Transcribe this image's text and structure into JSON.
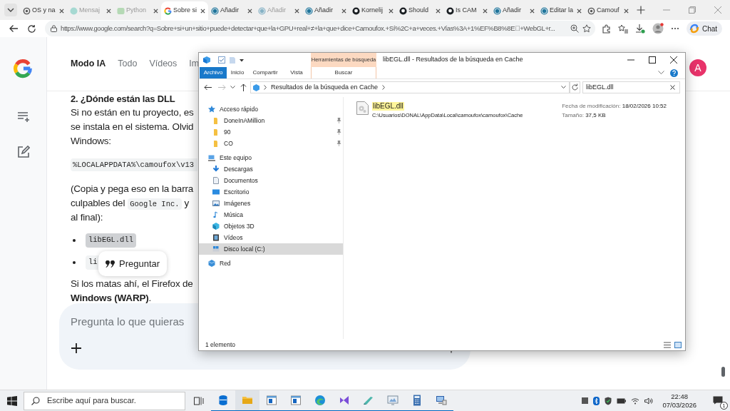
{
  "browser": {
    "tabs": [
      {
        "title": "OS y na",
        "kind": "knot",
        "selected": false,
        "sleeping": false
      },
      {
        "title": "Mensaj",
        "kind": "dot",
        "selected": false,
        "sleeping": true
      },
      {
        "title": "Python",
        "kind": "square",
        "selected": false,
        "sleeping": true
      },
      {
        "title": "Sobre si",
        "kind": "multicolor",
        "selected": true,
        "sleeping": false
      },
      {
        "title": "Añadir",
        "kind": "disc",
        "selected": false,
        "sleeping": false
      },
      {
        "title": "Añadir",
        "kind": "disc",
        "selected": false,
        "sleeping": true
      },
      {
        "title": "Añadir",
        "kind": "disc",
        "selected": false,
        "sleeping": false
      },
      {
        "title": "Kornelij",
        "kind": "cat",
        "selected": false,
        "sleeping": false
      },
      {
        "title": "Should",
        "kind": "cat",
        "selected": false,
        "sleeping": false
      },
      {
        "title": "Is CAM",
        "kind": "cat",
        "selected": false,
        "sleeping": false
      },
      {
        "title": "Añadir",
        "kind": "disc",
        "selected": false,
        "sleeping": false
      },
      {
        "title": "Editar la",
        "kind": "disc",
        "selected": false,
        "sleeping": false
      },
      {
        "title": "Camouf",
        "kind": "knot",
        "selected": false,
        "sleeping": false
      }
    ],
    "address": "https://www.google.com/search?q=Sobre+si+un+sitio+puede+detectar+que+la+GPU+real+≠+la+que+dice+Camoufox.+Sí%2C+a+veces.+Vías%3A+1%EF%B8%8E⃣+WebGL+r...",
    "chat_button": "Chat"
  },
  "page": {
    "nav": [
      {
        "label": "Modo IA",
        "selected": true
      },
      {
        "label": "Todo",
        "selected": false
      },
      {
        "label": "Vídeos",
        "selected": false
      },
      {
        "label": "Im",
        "selected": false
      }
    ],
    "avatar": "A",
    "heading": "2. ¿Dónde están las DLL",
    "blocks": [
      {
        "kind": "para",
        "lines": [
          "Si no están en tu proyecto, es",
          "se instala en el sistema. Olvid",
          "Windows:"
        ]
      },
      {
        "kind": "code",
        "text": "%LOCALAPPDATA%\\camoufox\\v13"
      },
      {
        "kind": "para",
        "lines": [
          "(Copia y pega eso en la barra",
          {
            "segments": [
              {
                "kind": "text",
                "text": "culpables del"
              },
              {
                "kind": "code",
                "text": "Google Inc."
              },
              {
                "kind": "text",
                "text": "y"
              }
            ]
          },
          "al final):"
        ]
      },
      {
        "kind": "list",
        "items": [
          {
            "text": "libEGL.dll",
            "highlighted": true
          },
          {
            "text": "li",
            "highlighted": false
          }
        ]
      },
      {
        "kind": "para",
        "lines": [
          "Si los matas ahí, el Firefox de",
          "**Windows (WARP)**."
        ]
      }
    ],
    "popup": "Preguntar",
    "prompt_placeholder": "Pregunta lo que quieras"
  },
  "explorer": {
    "title": "libEGL.dll - Resultados de la búsqueda en Cache",
    "context_group": "Herramientas de búsqueda",
    "ribbon_tabs": [
      {
        "label": "Archivo",
        "kind": "file"
      },
      {
        "label": "Inicio",
        "kind": "tab"
      },
      {
        "label": "Compartir",
        "kind": "tab"
      },
      {
        "label": "Vista",
        "kind": "tab"
      },
      {
        "label": "Buscar",
        "kind": "context"
      }
    ],
    "path": "Resultados de la búsqueda en Cache",
    "search": "libEGL.dll",
    "nav": [
      {
        "label": "Acceso rápido",
        "kind": "star",
        "selected": false,
        "children": [
          {
            "label": "DoneInAMillion",
            "kind": "folder",
            "pinned": true,
            "selected": false
          },
          {
            "label": "90",
            "kind": "folder",
            "pinned": true,
            "selected": false
          },
          {
            "label": "CO",
            "kind": "folder",
            "pinned": true,
            "selected": false
          }
        ]
      },
      {
        "label": "Este equipo",
        "kind": "pc",
        "selected": false,
        "children": [
          {
            "label": "Descargas",
            "kind": "download",
            "pinned": false,
            "selected": false
          },
          {
            "label": "Documentos",
            "kind": "document",
            "pinned": false,
            "selected": false
          },
          {
            "label": "Escritorio",
            "kind": "desktop",
            "pinned": false,
            "selected": false
          },
          {
            "label": "Imágenes",
            "kind": "image",
            "pinned": false,
            "selected": false
          },
          {
            "label": "Música",
            "kind": "music",
            "pinned": false,
            "selected": false
          },
          {
            "label": "Objetos 3D",
            "kind": "cube",
            "pinned": false,
            "selected": false
          },
          {
            "label": "Vídeos",
            "kind": "film",
            "pinned": false,
            "selected": false
          },
          {
            "label": "Disco local (C:)",
            "kind": "drive",
            "pinned": false,
            "selected": true
          }
        ]
      },
      {
        "label": "Red",
        "kind": "network",
        "selected": false
      }
    ],
    "results": [
      {
        "name": "libEGL.dll",
        "path": "C:\\Usuarios\\DONAL\\AppData\\Local\\camoufox\\camoufox\\Cache",
        "date_label": "Fecha de modificación:",
        "date": "18/02/2026 10:52",
        "size_label": "Tamaño:",
        "size": "37,5 KB"
      }
    ],
    "status": "1 elemento"
  },
  "taskbar": {
    "search_placeholder": "Escribe aquí para buscar.",
    "apps": [
      {
        "kind": "cylinder",
        "running": true,
        "selected": false
      },
      {
        "kind": "folder",
        "running": true,
        "selected": true
      },
      {
        "kind": "window",
        "running": true,
        "selected": false
      },
      {
        "kind": "window",
        "running": true,
        "selected": false
      },
      {
        "kind": "browser",
        "running": true,
        "selected": false
      },
      {
        "kind": "ribbon",
        "running": true,
        "selected": false
      },
      {
        "kind": "tablet",
        "running": true,
        "selected": false
      },
      {
        "kind": "monitor",
        "running": true,
        "selected": false
      },
      {
        "kind": "calculator",
        "running": true,
        "selected": false
      },
      {
        "kind": "computer",
        "running": true,
        "selected": false
      }
    ],
    "time": "22:48",
    "date": "07/03/2026",
    "notifications": "1"
  }
}
